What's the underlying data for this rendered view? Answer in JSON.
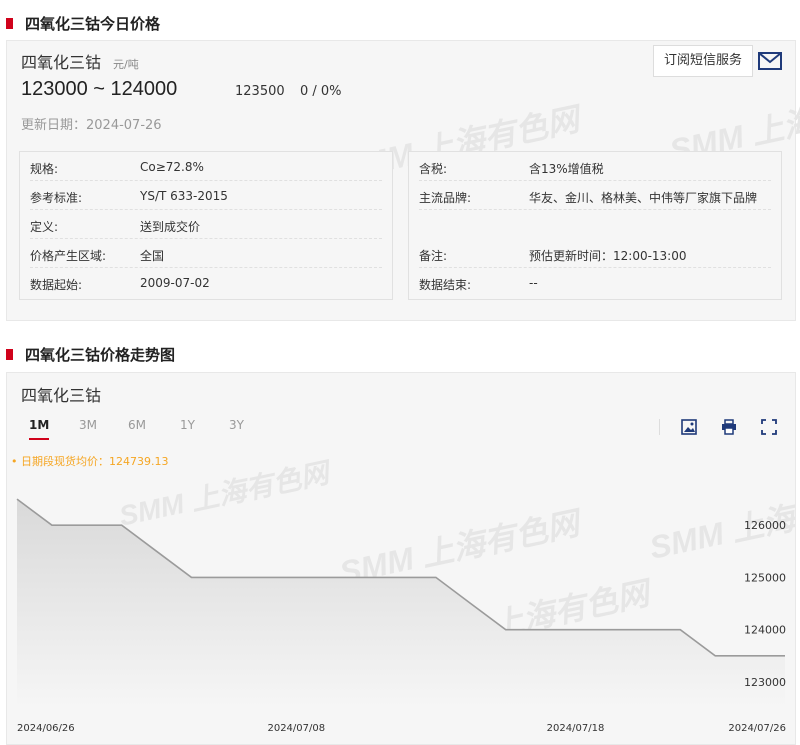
{
  "price_section": {
    "title": "四氧化三钴今日价格",
    "product_name": "四氧化三钴",
    "unit": "元/吨",
    "price_range": "123000 ~ 124000",
    "average": "123500",
    "change": "0 / 0%",
    "update_date": "更新日期：2024-07-26",
    "subscribe_label": "订阅短信服务",
    "watermark": "SMM 上海有色网"
  },
  "specs_left": [
    {
      "label": "规格:",
      "value": "Co≥72.8%"
    },
    {
      "label": "参考标准:",
      "value": "YS/T 633-2015"
    },
    {
      "label": "定义:",
      "value": "送到成交价"
    },
    {
      "label": "价格产生区域:",
      "value": "全国"
    },
    {
      "label": "数据起始:",
      "value": "2009-07-02"
    }
  ],
  "specs_right": [
    {
      "label": "含税:",
      "value": "含13%增值税"
    },
    {
      "label": "主流品牌:",
      "value": "华友、金川、格林美、中伟等厂家旗下品牌"
    },
    {
      "label": "备注:",
      "value": "预估更新时间：12:00-13:00"
    },
    {
      "label": "数据结束:",
      "value": "--"
    }
  ],
  "chart_section": {
    "title": "四氧化三钴价格走势图",
    "chart_name": "四氧化三钴",
    "tabs": [
      "1M",
      "3M",
      "6M",
      "1Y",
      "3Y"
    ],
    "active_tab": "1M",
    "average_note": "• 日期段现货均价：124739.13",
    "icons": [
      "image-download-icon",
      "print-icon",
      "fullscreen-icon"
    ]
  },
  "chart_data": {
    "type": "area",
    "x": [
      "2024-06-26",
      "2024-06-27",
      "2024-06-28",
      "2024-07-01",
      "2024-07-02",
      "2024-07-03",
      "2024-07-04",
      "2024-07-05",
      "2024-07-08",
      "2024-07-09",
      "2024-07-10",
      "2024-07-11",
      "2024-07-12",
      "2024-07-15",
      "2024-07-16",
      "2024-07-17",
      "2024-07-18",
      "2024-07-19",
      "2024-07-22",
      "2024-07-23",
      "2024-07-24",
      "2024-07-25",
      "2024-07-26"
    ],
    "values": [
      126500,
      126000,
      126000,
      126000,
      125500,
      125000,
      125000,
      125000,
      125000,
      125000,
      125000,
      125000,
      125000,
      124500,
      124000,
      124000,
      124000,
      124000,
      124000,
      124000,
      123500,
      123500,
      123500
    ],
    "x_tick_labels": [
      "2024/06/26",
      "2024/07/08",
      "2024/07/18",
      "2024/07/26"
    ],
    "y_ticks": [
      123000,
      124000,
      125000,
      126000
    ],
    "ylim": [
      122500,
      127000
    ],
    "grid": false,
    "colors": {
      "line": "#9b9b9b",
      "fill_top": "#d9d9d9",
      "fill_bottom": "#f6f6f6"
    }
  }
}
